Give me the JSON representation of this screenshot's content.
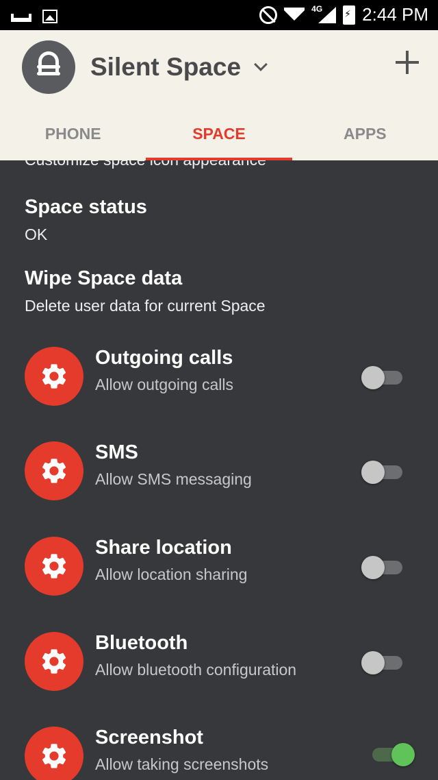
{
  "status_bar": {
    "time": "2:44 PM",
    "network_label": "4G",
    "icons": [
      "screen-cast-icon",
      "image-icon",
      "do-not-disturb-icon",
      "wifi-icon",
      "signal-icon",
      "battery-charging-icon"
    ]
  },
  "app_bar": {
    "title": "Silent Space",
    "logo_icon": "lock-icon",
    "dropdown_icon": "chevron-down-icon",
    "add_icon": "add-icon"
  },
  "tabs": [
    {
      "label": "PHONE",
      "active": false
    },
    {
      "label": "SPACE",
      "active": true
    },
    {
      "label": "APPS",
      "active": false
    }
  ],
  "colors": {
    "accent": "#e53b2c",
    "app_bar_bg": "#f3f1e8",
    "content_bg": "#37383c",
    "toggle_on": "#5fc35a"
  },
  "content": {
    "cut_off_text": "Customize space icon appearance",
    "prefs": [
      {
        "title": "Space status",
        "subtitle": "OK"
      },
      {
        "title": "Wipe Space data",
        "subtitle": "Delete user data for current Space"
      }
    ],
    "toggles": [
      {
        "title": "Outgoing calls",
        "subtitle": "Allow outgoing calls",
        "icon": "gear-icon",
        "enabled": false
      },
      {
        "title": "SMS",
        "subtitle": "Allow SMS messaging",
        "icon": "gear-icon",
        "enabled": false
      },
      {
        "title": "Share location",
        "subtitle": "Allow location sharing",
        "icon": "gear-icon",
        "enabled": false
      },
      {
        "title": "Bluetooth",
        "subtitle": "Allow bluetooth configuration",
        "icon": "gear-icon",
        "enabled": false
      },
      {
        "title": "Screenshot",
        "subtitle": "Allow taking screenshots",
        "icon": "gear-icon",
        "enabled": true
      }
    ]
  }
}
